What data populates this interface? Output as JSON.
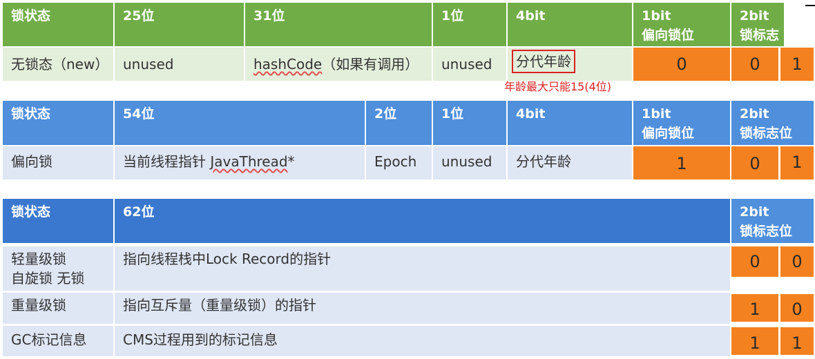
{
  "table1": {
    "headers": [
      "锁状态",
      "25位",
      "31位",
      "1位",
      "4bit",
      "1bit\n偏向锁位",
      "2bit\n锁标志"
    ],
    "row": [
      "无锁态（new）",
      "unused",
      "hashCode",
      "（如果有调用）",
      "unused",
      "分代年龄",
      "0",
      "0",
      "1"
    ],
    "note": "年龄最大只能15(4位)"
  },
  "table2": {
    "headers": [
      "锁状态",
      "54位",
      "2位",
      "1位",
      "4bit",
      "1bit\n偏向锁位",
      "2bit\n锁标志位"
    ],
    "row": [
      "偏向锁",
      "当前线程指针 ",
      "JavaThread",
      "*",
      "Epoch",
      "unused",
      "分代年龄",
      "1",
      "0",
      "1"
    ]
  },
  "table3": {
    "headers": [
      "锁状态",
      "62位",
      "2bit\n锁标志位"
    ],
    "rows": [
      {
        "state": "轻量级锁\n自旋锁 无锁",
        "content": "指向线程栈中Lock Record的指针",
        "b1": "0",
        "b2": "0"
      },
      {
        "state": "重量级锁",
        "content": "指向互斥量（重量级锁）的指针",
        "b1": "1",
        "b2": "0"
      },
      {
        "state": "GC标记信息",
        "content": "CMS过程用到的标记信息",
        "b1": "1",
        "b2": "1"
      }
    ]
  },
  "colors": {
    "green_header": "#70ad47",
    "green_light": "#e3eedb",
    "blue_header": "#4f8fdc",
    "blue_light": "#dfe6f4",
    "orange": "#f4811f",
    "note_red": "#d92121"
  }
}
